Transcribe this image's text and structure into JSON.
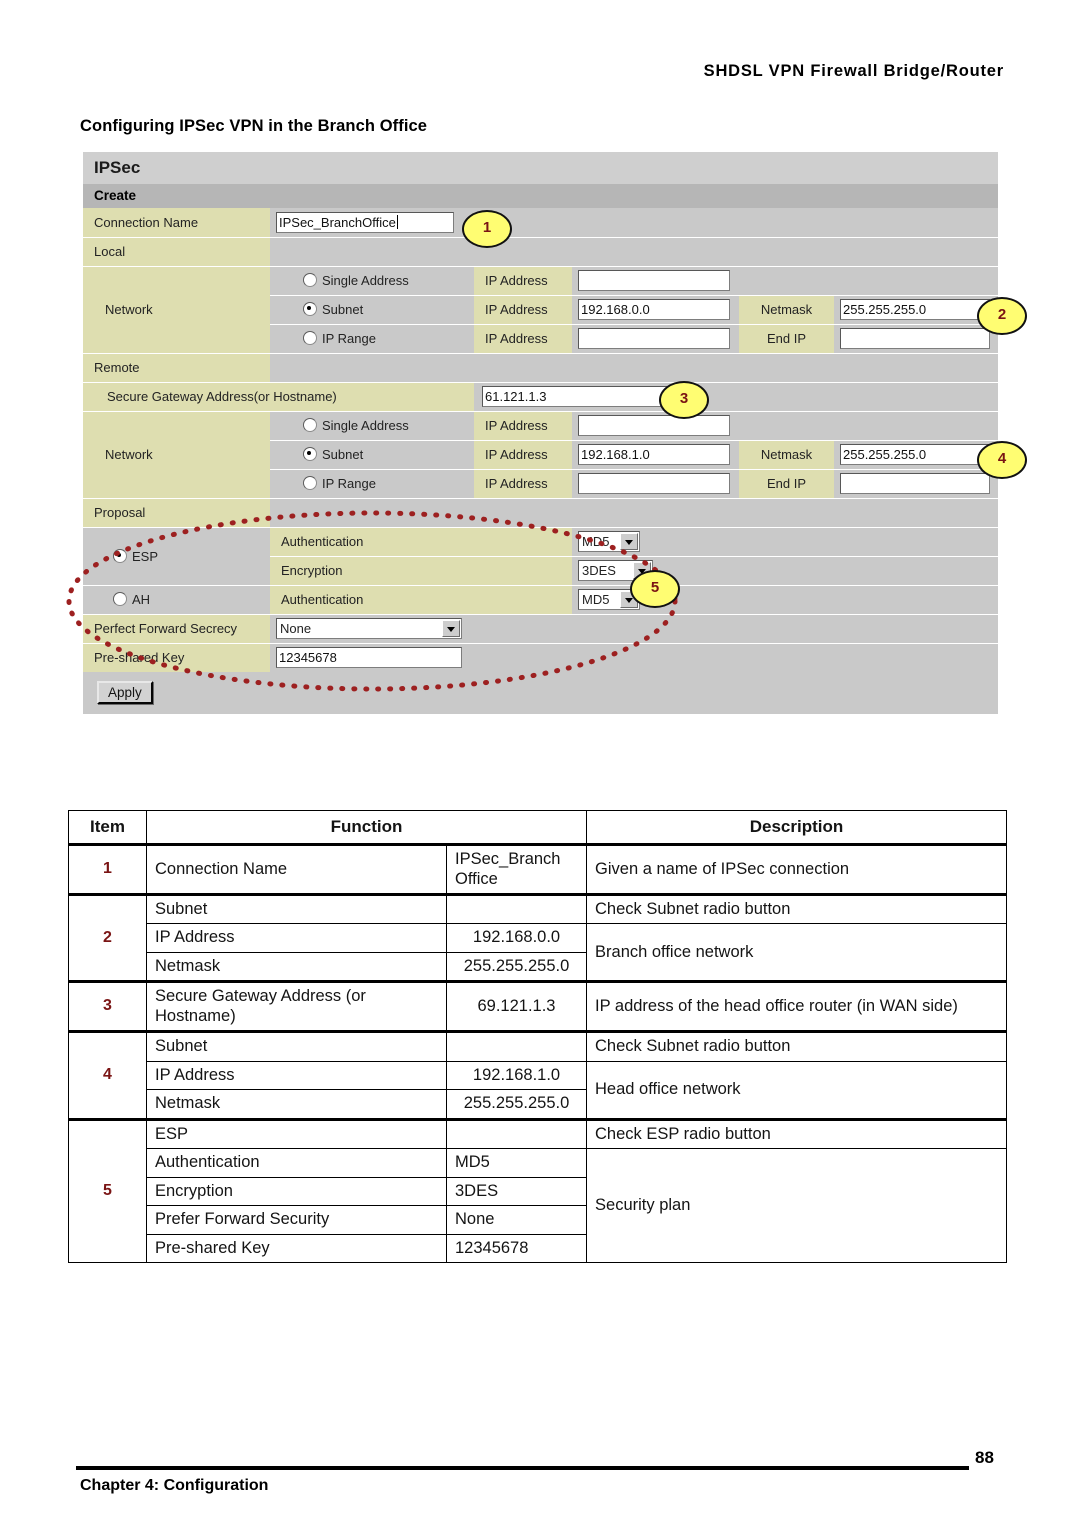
{
  "page": {
    "header_title": "SHDSL VPN Firewall Bridge/Router",
    "section_heading": "Configuring IPSec VPN in the Branch Office",
    "footer_chapter": "Chapter 4: Configuration",
    "page_number": "88",
    "accent_color": "#7a1414",
    "callout_fill": "#fffd72",
    "label_bg": "#dedeb0",
    "panel_bg": "#c9c9c9"
  },
  "panel": {
    "title": "IPSec",
    "subtitle": "Create",
    "connection_name_label": "Connection Name",
    "connection_name_value": "IPSec_BranchOffice",
    "local_label": "Local",
    "remote_label": "Remote",
    "network_label": "Network",
    "single_address_label": "Single Address",
    "subnet_label": "Subnet",
    "ip_range_label": "IP Range",
    "ip_address_label": "IP Address",
    "netmask_label": "Netmask",
    "end_ip_label": "End IP",
    "secure_gateway_label": "Secure Gateway Address(or Hostname)",
    "secure_gateway_value": "61.121.1.3",
    "proposal_label": "Proposal",
    "esp_label": "ESP",
    "ah_label": "AH",
    "authentication_label": "Authentication",
    "encryption_label": "Encryption",
    "pfs_label": "Perfect Forward Secrecy",
    "psk_label": "Pre-shared Key",
    "apply_label": "Apply",
    "local": {
      "single_ip": "",
      "subnet_ip": "192.168.0.0",
      "subnet_netmask": "255.255.255.0",
      "range_ip": "",
      "range_end_ip": ""
    },
    "remote": {
      "single_ip": "",
      "subnet_ip": "192.168.1.0",
      "subnet_netmask": "255.255.255.0",
      "range_ip": "",
      "range_end_ip": ""
    },
    "proposal": {
      "esp_authentication": "MD5",
      "esp_encryption": "3DES",
      "ah_authentication": "MD5",
      "pfs": "None",
      "psk": "12345678"
    },
    "callouts": {
      "c1": "1",
      "c2": "2",
      "c3": "3",
      "c4": "4",
      "c5": "5"
    }
  },
  "item_table": {
    "headers": {
      "item": "Item",
      "function": "Function",
      "description": "Description"
    },
    "rows": [
      {
        "item": "1",
        "function": "Connection Name",
        "value": "IPSec_Branch Office",
        "description": "Given a name of IPSec connection"
      },
      {
        "item": "2",
        "function": "Subnet",
        "value": "",
        "description": "Check Subnet radio button"
      },
      {
        "item": "",
        "function": "IP Address",
        "value": "192.168.0.0",
        "description": "Branch office network"
      },
      {
        "item": "",
        "function": "Netmask",
        "value": "255.255.255.0",
        "description": ""
      },
      {
        "item": "3",
        "function": "Secure Gateway Address (or Hostname)",
        "value": "69.121.1.3",
        "description": "IP address of the head office router (in WAN side)"
      },
      {
        "item": "4",
        "function": "Subnet",
        "value": "",
        "description": "Check Subnet radio button"
      },
      {
        "item": "",
        "function": "IP Address",
        "value": "192.168.1.0",
        "description": "Head office network"
      },
      {
        "item": "",
        "function": "Netmask",
        "value": "255.255.255.0",
        "description": ""
      },
      {
        "item": "5",
        "function": "ESP",
        "value": "",
        "description": "Check ESP radio button"
      },
      {
        "item": "",
        "function": "Authentication",
        "value": "MD5",
        "description": "Security plan"
      },
      {
        "item": "",
        "function": "Encryption",
        "value": "3DES",
        "description": ""
      },
      {
        "item": "",
        "function": "Prefer Forward Security",
        "value": "None",
        "description": ""
      },
      {
        "item": "",
        "function": "Pre-shared Key",
        "value": "12345678",
        "description": ""
      }
    ]
  }
}
